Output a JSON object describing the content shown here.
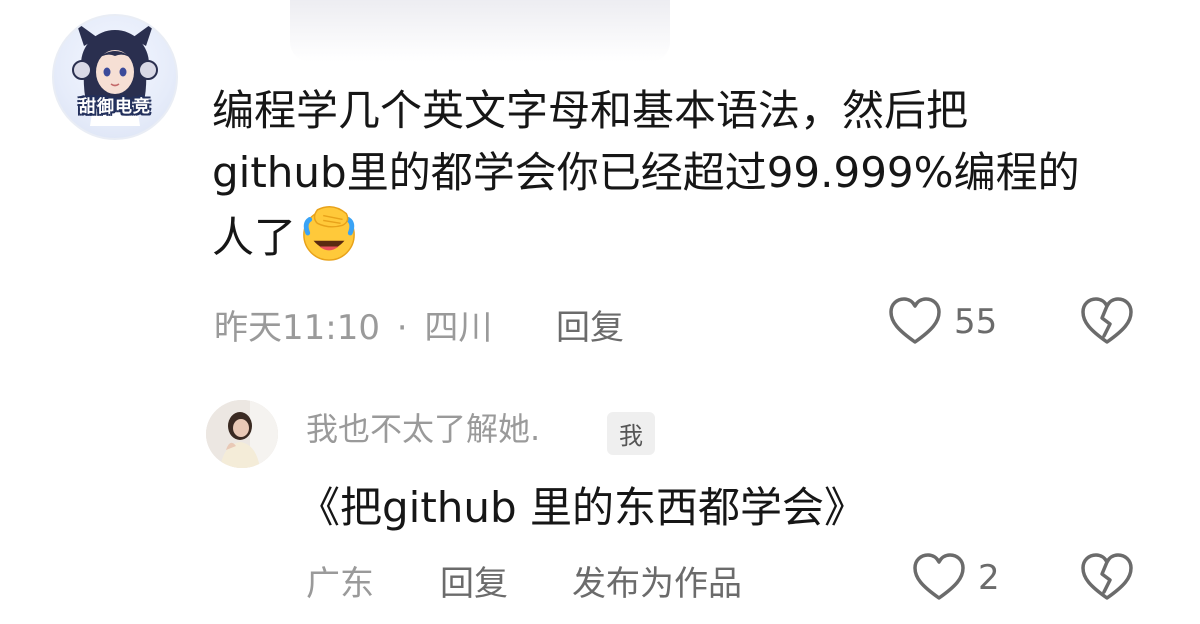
{
  "comment": {
    "avatar_label": "甜御电竞",
    "text_lines": [
      "编程学几个英文字母和基本语法，然后把",
      "github里的都学会你已经超过99.999%编程的",
      "人了"
    ],
    "emoji": "facepalm-laughing-emoji",
    "time": "昨天11:10",
    "location": "四川",
    "separator": "·",
    "reply_label": "回复",
    "likes": "55"
  },
  "reply": {
    "username": "我也不太了解她.",
    "badge": "我",
    "text": "《把github 里的东西都学会》",
    "location": "广东",
    "reply_label": "回复",
    "publish_label": "发布为作品",
    "likes": "2"
  },
  "colors": {
    "meta_gray": "#9a9a9a",
    "action_gray": "#6b6b6b",
    "text": "#161616"
  }
}
